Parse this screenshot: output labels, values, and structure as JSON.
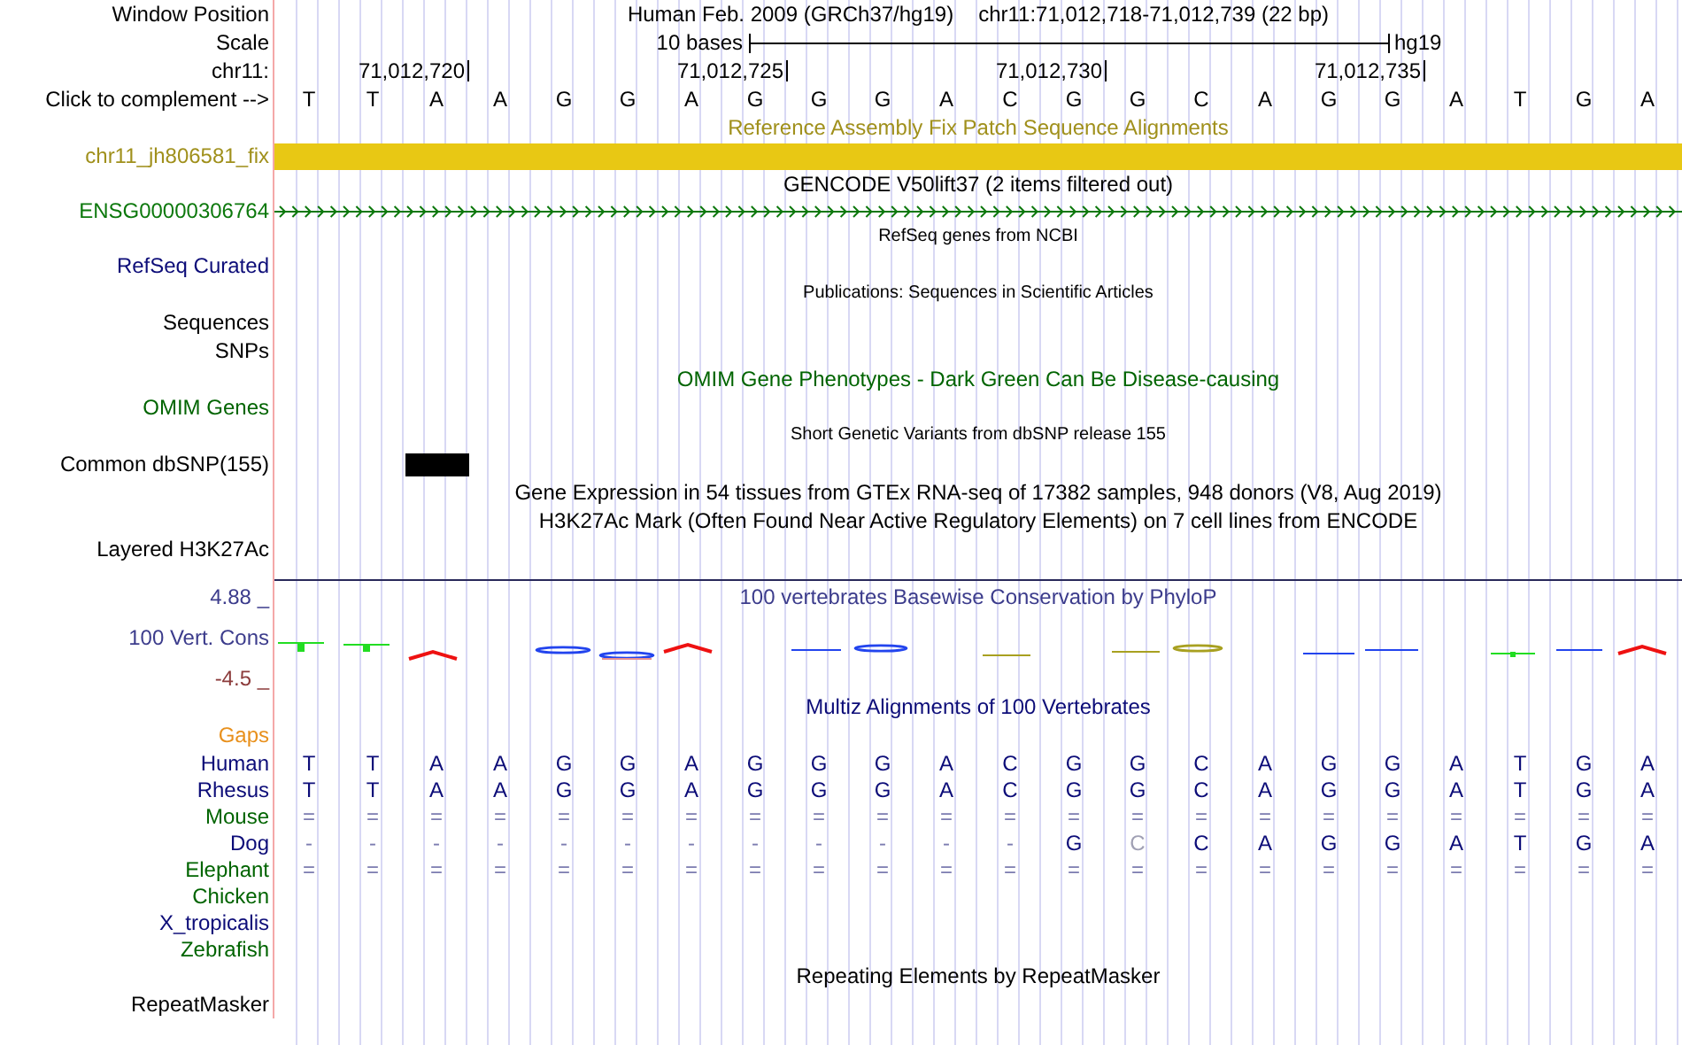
{
  "header": {
    "window_position_label": "Window Position",
    "assembly": "Human Feb. 2009 (GRCh37/hg19)",
    "position": "chr11:71,012,718-71,012,739 (22 bp)",
    "scale_label": "Scale",
    "scale_text": "10 bases",
    "scale_db": "hg19",
    "chrom_label": "chr11:",
    "ticks": [
      "71,012,720",
      "71,012,725",
      "71,012,730",
      "71,012,735"
    ],
    "complement_label": "Click to complement -->",
    "bases": [
      "T",
      "T",
      "A",
      "A",
      "G",
      "G",
      "A",
      "G",
      "G",
      "G",
      "A",
      "C",
      "G",
      "G",
      "C",
      "A",
      "G",
      "G",
      "A",
      "T",
      "G",
      "A"
    ]
  },
  "tracks": [
    {
      "kind": "title",
      "text": "Reference Assembly Fix Patch Sequence Alignments",
      "color": "#a0901c"
    },
    {
      "kind": "patch",
      "label": "chr11_jh806581_fix",
      "color": "#a0901c"
    },
    {
      "kind": "title",
      "text": "GENCODE V50lift37 (2 items filtered out)",
      "color": "#000000"
    },
    {
      "kind": "gene",
      "label": "ENSG00000306764",
      "color": "#0c780c"
    },
    {
      "kind": "note",
      "text": "RefSeq genes from NCBI",
      "color": "#000000"
    },
    {
      "kind": "empty",
      "label": "RefSeq Curated",
      "color": "#0c0c78"
    },
    {
      "kind": "note",
      "text": "Publications: Sequences in Scientific Articles",
      "color": "#000000"
    },
    {
      "kind": "empty",
      "label": "Sequences",
      "color": "#000000"
    },
    {
      "kind": "empty",
      "label": "SNPs",
      "color": "#000000"
    },
    {
      "kind": "title",
      "text": "OMIM Gene Phenotypes - Dark Green Can Be Disease-causing",
      "color": "#006400"
    },
    {
      "kind": "empty",
      "label": "OMIM Genes",
      "color": "#006400"
    },
    {
      "kind": "note",
      "text": "Short Genetic Variants from dbSNP release 155",
      "color": "#000000"
    },
    {
      "kind": "snp",
      "label": "Common dbSNP(155)",
      "color": "#000000"
    },
    {
      "kind": "title",
      "text": "Gene Expression in 54 tissues from GTEx RNA-seq of 17382 samples, 948 donors (V8, Aug 2019)",
      "color": "#000000"
    },
    {
      "kind": "title",
      "text": "H3K27Ac Mark (Often Found Near Active Regulatory Elements) on 7 cell lines from ENCODE",
      "color": "#000000"
    },
    {
      "kind": "empty",
      "label": "Layered H3K27Ac",
      "color": "#000000"
    },
    {
      "kind": "title",
      "text": "100 vertebrates Basewise Conservation by PhyloP",
      "color": "#3c3c8c",
      "label": "4.88 _",
      "rule": true
    },
    {
      "kind": "logo",
      "label": "100 Vert. Cons",
      "color": "#3c3c8c"
    },
    {
      "kind": "empty",
      "label": "-4.5 _",
      "color": "#8c3c3c"
    },
    {
      "kind": "title",
      "text": "Multiz Alignments of 100 Vertebrates",
      "color": "#0c0c78"
    },
    {
      "kind": "empty",
      "label": "Gaps",
      "color": "#e8901c"
    },
    {
      "kind": "species",
      "label": "Human",
      "color": "#0c0c78",
      "bases": [
        "T",
        "T",
        "A",
        "A",
        "G",
        "G",
        "A",
        "G",
        "G",
        "G",
        "A",
        "C",
        "G",
        "G",
        "C",
        "A",
        "G",
        "G",
        "A",
        "T",
        "G",
        "A"
      ]
    },
    {
      "kind": "species",
      "label": "Rhesus",
      "color": "#0c0c78",
      "bases": [
        "T",
        "T",
        "A",
        "A",
        "G",
        "G",
        "A",
        "G",
        "G",
        "G",
        "A",
        "C",
        "G",
        "G",
        "C",
        "A",
        "G",
        "G",
        "A",
        "T",
        "G",
        "A"
      ]
    },
    {
      "kind": "species",
      "label": "Mouse",
      "color": "#006400",
      "bases": [
        "=",
        "=",
        "=",
        "=",
        "=",
        "=",
        "=",
        "=",
        "=",
        "=",
        "=",
        "=",
        "=",
        "=",
        "=",
        "=",
        "=",
        "=",
        "=",
        "=",
        "=",
        "="
      ]
    },
    {
      "kind": "species",
      "label": "Dog",
      "color": "#0c0c78",
      "bases": [
        "-",
        "-",
        "-",
        "-",
        "-",
        "-",
        "-",
        "-",
        "-",
        "-",
        "-",
        "-",
        "G",
        {
          "base": "C",
          "dim": true
        },
        "C",
        "A",
        "G",
        "G",
        "A",
        "T",
        "G",
        "A"
      ]
    },
    {
      "kind": "species",
      "label": "Elephant",
      "color": "#006400",
      "bases": [
        "=",
        "=",
        "=",
        "=",
        "=",
        "=",
        "=",
        "=",
        "=",
        "=",
        "=",
        "=",
        "=",
        "=",
        "=",
        "=",
        "=",
        "=",
        "=",
        "=",
        "=",
        "="
      ]
    },
    {
      "kind": "species",
      "label": "Chicken",
      "color": "#006400"
    },
    {
      "kind": "species",
      "label": "X_tropicalis",
      "color": "#0c0c78"
    },
    {
      "kind": "species",
      "label": "Zebrafish",
      "color": "#006400"
    },
    {
      "kind": "title",
      "text": "Repeating Elements by RepeatMasker",
      "color": "#000000"
    },
    {
      "kind": "empty",
      "label": "RepeatMasker",
      "color": "#000000"
    }
  ]
}
